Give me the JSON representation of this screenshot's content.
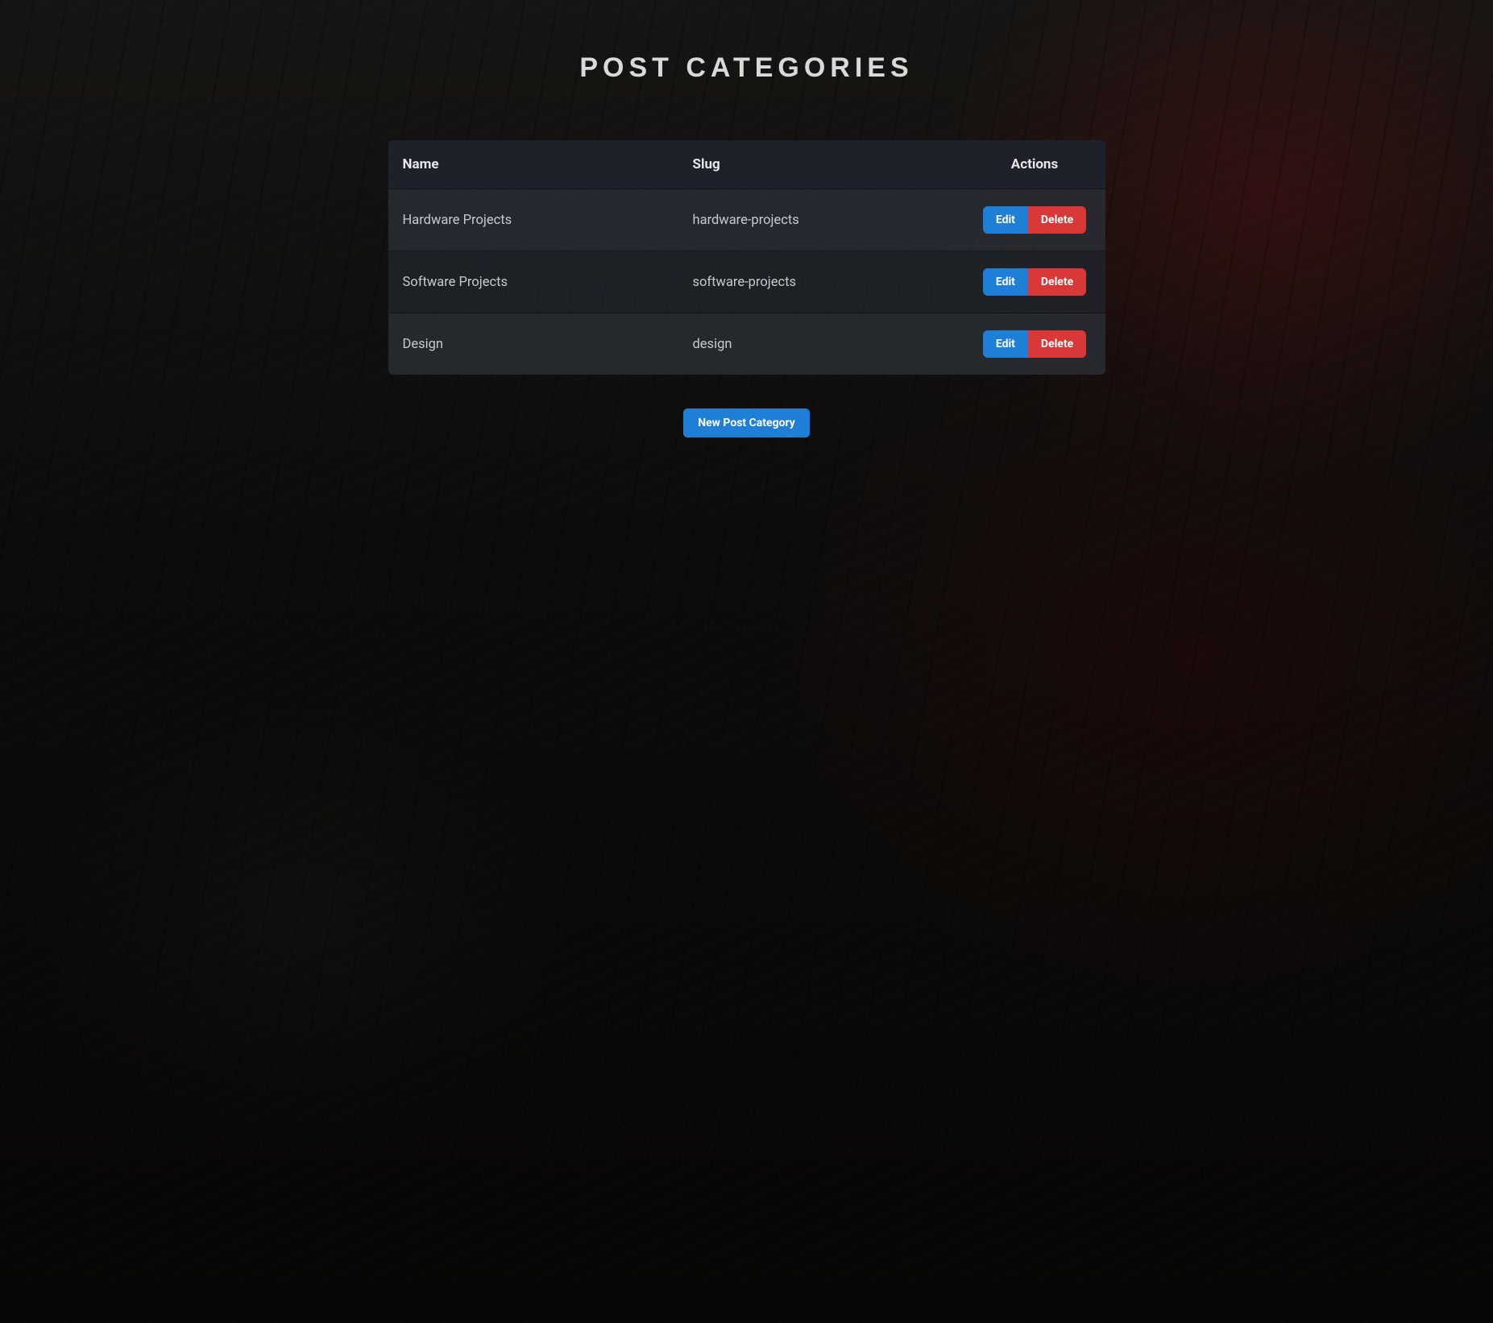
{
  "page": {
    "title": "POST CATEGORIES"
  },
  "table": {
    "headers": {
      "name": "Name",
      "slug": "Slug",
      "actions": "Actions"
    },
    "rows": [
      {
        "name": "Hardware Projects",
        "slug": "hardware-projects"
      },
      {
        "name": "Software Projects",
        "slug": "software-projects"
      },
      {
        "name": "Design",
        "slug": "design"
      }
    ]
  },
  "buttons": {
    "edit": "Edit",
    "delete": "Delete",
    "new": "New Post Category"
  }
}
